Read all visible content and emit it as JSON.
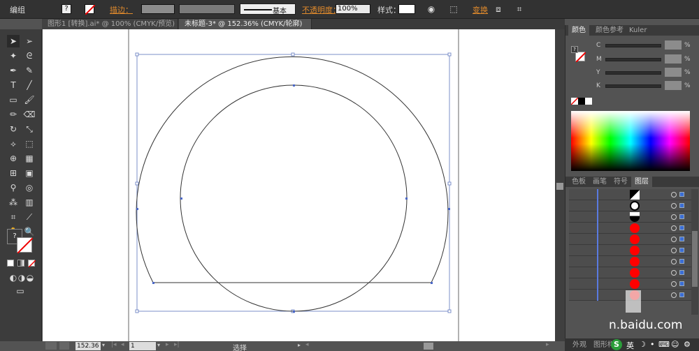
{
  "control_bar": {
    "group_label": "编组",
    "stroke_label": "描边：",
    "basic_label": "基本",
    "opacity_label": "不透明度：",
    "opacity_value": "100%",
    "style_label": "样式：",
    "transform_label": "变换"
  },
  "tabs": [
    {
      "label": "图形1 [转换].ai* @ 100% (CMYK/预览)"
    },
    {
      "label": "未标题-3* @ 152.36% (CMYK/轮廓)"
    }
  ],
  "color_panel": {
    "tabs": [
      "颜色",
      "颜色参考",
      "Kuler"
    ],
    "channels": [
      {
        "name": "C",
        "value": "",
        "unit": "%"
      },
      {
        "name": "M",
        "value": "",
        "unit": "%"
      },
      {
        "name": "Y",
        "value": "",
        "unit": "%"
      },
      {
        "name": "K",
        "value": "",
        "unit": "%"
      }
    ]
  },
  "layers_panel": {
    "tabs": [
      "色板",
      "画笔",
      "符号",
      "图层"
    ],
    "rows": [
      {
        "thumb": "half-white-circle"
      },
      {
        "thumb": "white-circle"
      },
      {
        "thumb": "half-black-circle"
      },
      {
        "thumb": "red-circle"
      },
      {
        "thumb": "red-circle"
      },
      {
        "thumb": "red-circle"
      },
      {
        "thumb": "red-circle"
      },
      {
        "thumb": "red-circle"
      },
      {
        "thumb": "red-circle"
      },
      {
        "thumb": "red-circle"
      }
    ]
  },
  "bottom_right_tabs": [
    "外观",
    "图形样式"
  ],
  "status": {
    "zoom": "152.36",
    "page": "1",
    "mode": "选择"
  },
  "watermark": "n.baidu.com",
  "ime_text": "英",
  "colors": {
    "accent_orange": "#e08a2c",
    "path_blue": "#4a67c7",
    "layer_red": "#ff0000"
  }
}
